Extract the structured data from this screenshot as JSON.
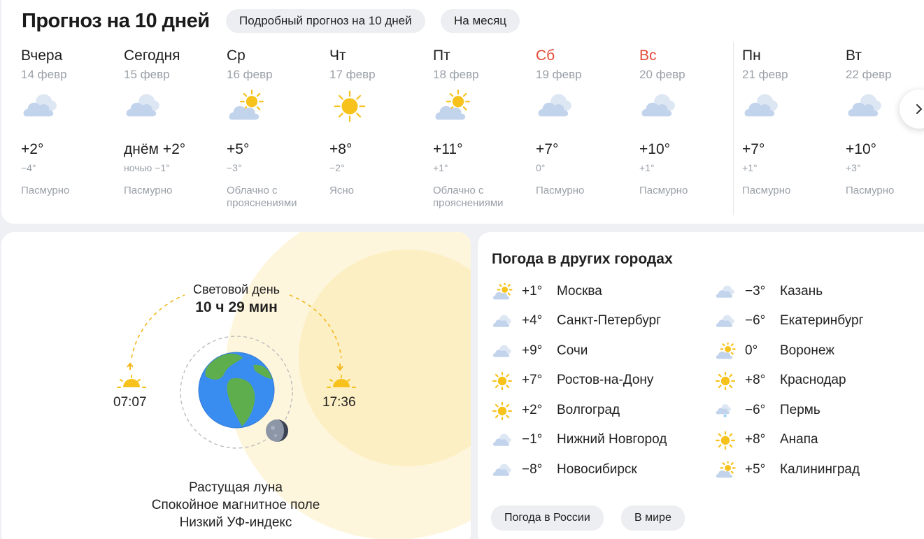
{
  "header": {
    "title": "Прогноз на 10 дней",
    "detail_button": "Подробный прогноз на 10 дней",
    "month_button": "На месяц"
  },
  "days": [
    {
      "name": "Вчера",
      "date": "14 февр",
      "temp": "+2°",
      "night": "−4°",
      "condition": "Пасмурно",
      "icon": "overcast-icon",
      "weekend": false
    },
    {
      "name": "Сегодня",
      "date": "15 февр",
      "temp": "днём +2°",
      "night": "ночью −1°",
      "condition": "Пасмурно",
      "icon": "overcast-icon",
      "weekend": false
    },
    {
      "name": "Ср",
      "date": "16 февр",
      "temp": "+5°",
      "night": "−3°",
      "condition": "Облачно с прояснениями",
      "icon": "partly-cloudy-icon",
      "weekend": false
    },
    {
      "name": "Чт",
      "date": "17 февр",
      "temp": "+8°",
      "night": "−2°",
      "condition": "Ясно",
      "icon": "sun-icon",
      "weekend": false
    },
    {
      "name": "Пт",
      "date": "18 февр",
      "temp": "+11°",
      "night": "+1°",
      "condition": "Облачно с прояснениями",
      "icon": "partly-cloudy-icon",
      "weekend": false
    },
    {
      "name": "Сб",
      "date": "19 февр",
      "temp": "+7°",
      "night": "0°",
      "condition": "Пасмурно",
      "icon": "overcast-icon",
      "weekend": true
    },
    {
      "name": "Вс",
      "date": "20 февр",
      "temp": "+10°",
      "night": "+1°",
      "condition": "Пасмурно",
      "icon": "overcast-icon",
      "weekend": true
    },
    {
      "name": "Пн",
      "date": "21 февр",
      "temp": "+7°",
      "night": "+1°",
      "condition": "Пасмурно",
      "icon": "overcast-icon",
      "weekend": false
    },
    {
      "name": "Вт",
      "date": "22 февр",
      "temp": "+10°",
      "night": "+3°",
      "condition": "Пасмурно",
      "icon": "overcast-icon",
      "weekend": false
    }
  ],
  "daylight": {
    "title": "Световой день",
    "duration": "10 ч 29 мин",
    "sunrise": "07:07",
    "sunset": "17:36",
    "moon": "Растущая луна",
    "magnetic": "Спокойное магнитное поле",
    "uv": "Низкий УФ-индекс"
  },
  "cities": {
    "title": "Погода в других городах",
    "left": [
      {
        "temp": "+1°",
        "name": "Москва",
        "icon": "partly-cloudy-icon"
      },
      {
        "temp": "+4°",
        "name": "Санкт-Петербург",
        "icon": "overcast-icon"
      },
      {
        "temp": "+9°",
        "name": "Сочи",
        "icon": "overcast-icon"
      },
      {
        "temp": "+7°",
        "name": "Ростов-на-Дону",
        "icon": "sun-icon"
      },
      {
        "temp": "+2°",
        "name": "Волгоград",
        "icon": "sun-icon"
      },
      {
        "temp": "−1°",
        "name": "Нижний Новгород",
        "icon": "overcast-icon"
      },
      {
        "temp": "−8°",
        "name": "Новосибирск",
        "icon": "overcast-icon"
      }
    ],
    "right": [
      {
        "temp": "−3°",
        "name": "Казань",
        "icon": "overcast-icon"
      },
      {
        "temp": "−6°",
        "name": "Екатеринбург",
        "icon": "overcast-icon"
      },
      {
        "temp": "0°",
        "name": "Воронеж",
        "icon": "partly-cloudy-icon"
      },
      {
        "temp": "+8°",
        "name": "Краснодар",
        "icon": "sun-icon"
      },
      {
        "temp": "−6°",
        "name": "Пермь",
        "icon": "snow-icon"
      },
      {
        "temp": "+8°",
        "name": "Анапа",
        "icon": "sun-icon"
      },
      {
        "temp": "+5°",
        "name": "Калининград",
        "icon": "partly-cloudy-icon"
      }
    ],
    "russia_button": "Погода в России",
    "world_button": "В мире"
  },
  "colors": {
    "weekend": "#e34a38",
    "secondary_text": "#9aa0a8",
    "sun": "#f7c21c",
    "cloud": "#c9d6ea",
    "sunlight_glow": "#fdf0c6"
  }
}
